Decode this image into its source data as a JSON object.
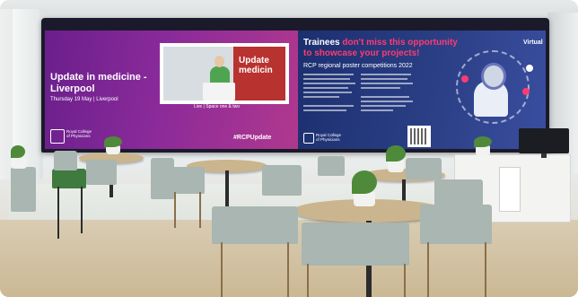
{
  "screen": {
    "left_panel": {
      "title_line1": "Update in medicine -",
      "title_line2": "Liverpool",
      "date_line": "Thursday 19 May | Liverpool",
      "logo_text_line1": "Royal College",
      "logo_text_line2": "of Physicians",
      "video_overlay_text_line1": "Update",
      "video_overlay_text_line2": "medicin",
      "live_caption": "Live | Space one & two",
      "hashtag": "#RCPUpdate"
    },
    "right_panel": {
      "headline_part1": "Trainees ",
      "headline_highlight": "don't miss this opportunity",
      "headline_line2": "to showcase your projects!",
      "subtitle": "RCP regional poster competitions 2022",
      "badge": "Virtual",
      "logo_text_line1": "Royal College",
      "logo_text_line2": "of Physicians"
    }
  },
  "colors": {
    "panel_left_purple": "#7a2592",
    "panel_right_navy": "#24377a",
    "highlight_pink": "#ff3b70",
    "chair_grey": "#a9b6b1",
    "chair_green": "#3f7a3e",
    "table_wood": "#cbb58e",
    "floor_wood": "#cbb894"
  }
}
